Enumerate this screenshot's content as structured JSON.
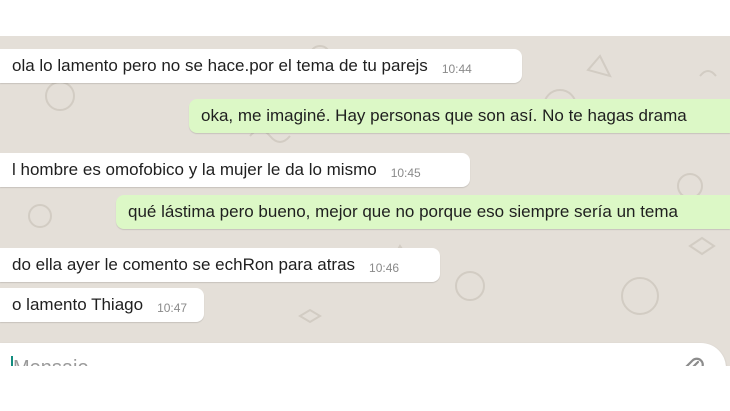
{
  "messages": [
    {
      "dir": "in",
      "text": "ola lo lamento pero no se hace.por el tema de tu parejs",
      "time": "10:44"
    },
    {
      "dir": "out",
      "text": "oka, me imaginé. Hay personas que son así. No te hagas drama",
      "time": ""
    },
    {
      "dir": "in",
      "text": "l hombre es omofobico y la mujer le da lo mismo",
      "time": "10:45"
    },
    {
      "dir": "out",
      "text": "qué lástima pero bueno, mejor que no porque eso siempre sería un tema",
      "time": ""
    },
    {
      "dir": "in",
      "text": "do ella ayer le comento se echRon para atras",
      "time": "10:46"
    },
    {
      "dir": "in",
      "text": "o lamento Thiago",
      "time": "10:47"
    }
  ],
  "composer": {
    "placeholder": "Mensaje",
    "attach_icon": "paperclip-icon"
  },
  "colors": {
    "incoming_bubble": "#ffffff",
    "outgoing_bubble": "#dcf8c6",
    "chat_background": "#e4dfd8",
    "caret": "#128c7e"
  }
}
